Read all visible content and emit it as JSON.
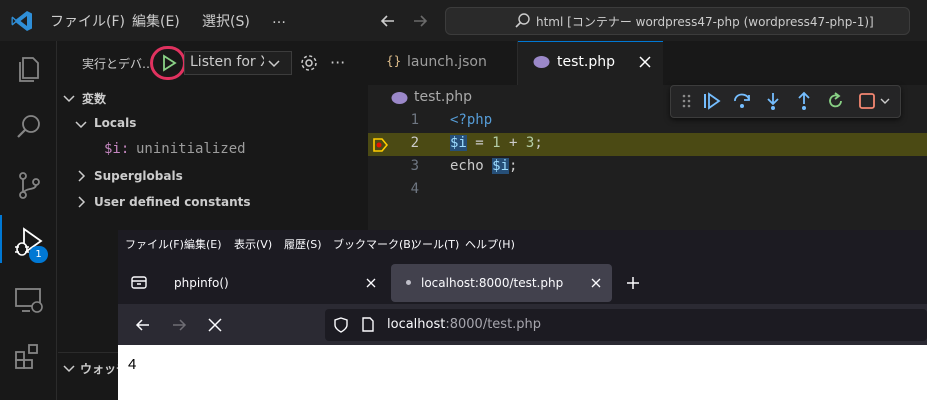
{
  "titlebar": {
    "menus": [
      "ファイル(F)",
      "編集(E)",
      "選択(S)",
      "…"
    ],
    "command_center": "html [コンテナー wordpress47-php (wordpress47-php-1)]"
  },
  "activity": {
    "debug_badge": "1"
  },
  "sidebar": {
    "title": "実行とデバ…",
    "config": "Listen for Xdebug",
    "section_variables": "変数",
    "locals": "Locals",
    "var_name": "$i:",
    "var_value": "uninitialized",
    "superglobals": "Superglobals",
    "user_constants": "User defined constants",
    "watch": "ウォッチ"
  },
  "editor": {
    "tabs": [
      {
        "icon": "{}",
        "label": "launch.json"
      },
      {
        "icon": "php",
        "label": "test.php"
      }
    ],
    "breadcrumb": "test.php",
    "lines": [
      {
        "n": "1",
        "code": "<?php"
      },
      {
        "n": "2",
        "code": "$i = 1 + 3;"
      },
      {
        "n": "3",
        "code": "echo $i;"
      },
      {
        "n": "4",
        "code": ""
      }
    ],
    "current_line": 2,
    "colors": {
      "highlight": "#4b4a14",
      "breakpoint": "#ffcc00",
      "keyword": "#569cd6",
      "variable": "#9cdcfe"
    }
  },
  "browser": {
    "menus": [
      "ファイル(F)",
      "編集(E)",
      "表示(V)",
      "履歴(S)",
      "ブックマーク(B)",
      "ツール(T)",
      "ヘルプ(H)"
    ],
    "tabs": [
      {
        "label": "phpinfo()"
      },
      {
        "label": "localhost:8000/test.php"
      }
    ],
    "url_host": "localhost",
    "url_rest": ":8000/test.php",
    "page_output": "4"
  }
}
